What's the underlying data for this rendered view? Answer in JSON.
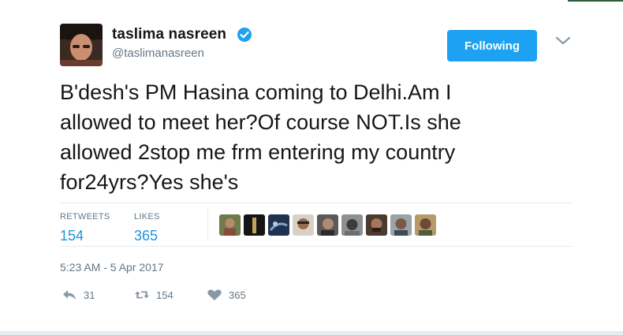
{
  "author": {
    "display_name": "taslima nasreen",
    "handle": "@taslimanasreen",
    "verified": true
  },
  "follow_button": {
    "label": "Following"
  },
  "tweet": {
    "text": "B'desh's PM Hasina coming to Delhi.Am I\nallowed to meet her?Of course NOT.Is she\nallowed 2stop me frm entering my country\nfor24yrs?Yes she's"
  },
  "stats": {
    "retweets_label": "RETWEETS",
    "retweets_value": "154",
    "likes_label": "LIKES",
    "likes_value": "365"
  },
  "timestamp": "5:23 AM - 5 Apr 2017",
  "actions": {
    "reply_count": "31",
    "retweet_count": "154",
    "like_count": "365"
  },
  "colors": {
    "accent": "#1da1f2",
    "stat_value": "#1b95e0",
    "muted": "#657786",
    "text": "#14171a"
  }
}
